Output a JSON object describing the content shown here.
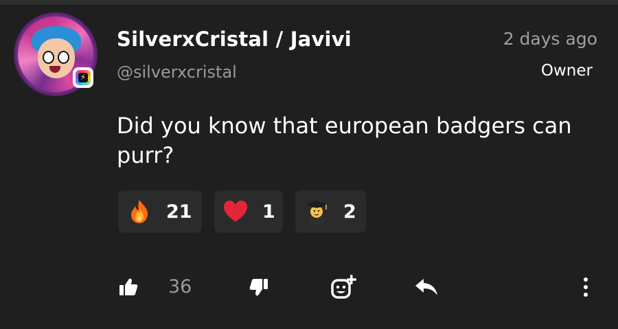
{
  "post": {
    "author_name": "SilverxCristal / Javivi",
    "author_handle": "@silverxcristal",
    "timestamp": "2 days ago",
    "role": "Owner",
    "text": "Did you know that european badgers can purr?"
  },
  "reactions": [
    {
      "icon": "fire-emoji-icon",
      "count": "21"
    },
    {
      "icon": "heart-emoji-icon",
      "count": "1"
    },
    {
      "icon": "student-emoji-icon",
      "count": "2"
    }
  ],
  "actions": {
    "like_count": "36",
    "like_icon": "thumbs-up-icon",
    "dislike_icon": "thumbs-down-icon",
    "add_reaction_icon": "add-emoji-icon",
    "reply_icon": "reply-arrow-icon",
    "more_icon": "more-vertical-icon"
  },
  "colors": {
    "background": "#1f1f1f",
    "reaction_bg": "#2b2b2b",
    "muted_text": "#9a9a9a"
  }
}
